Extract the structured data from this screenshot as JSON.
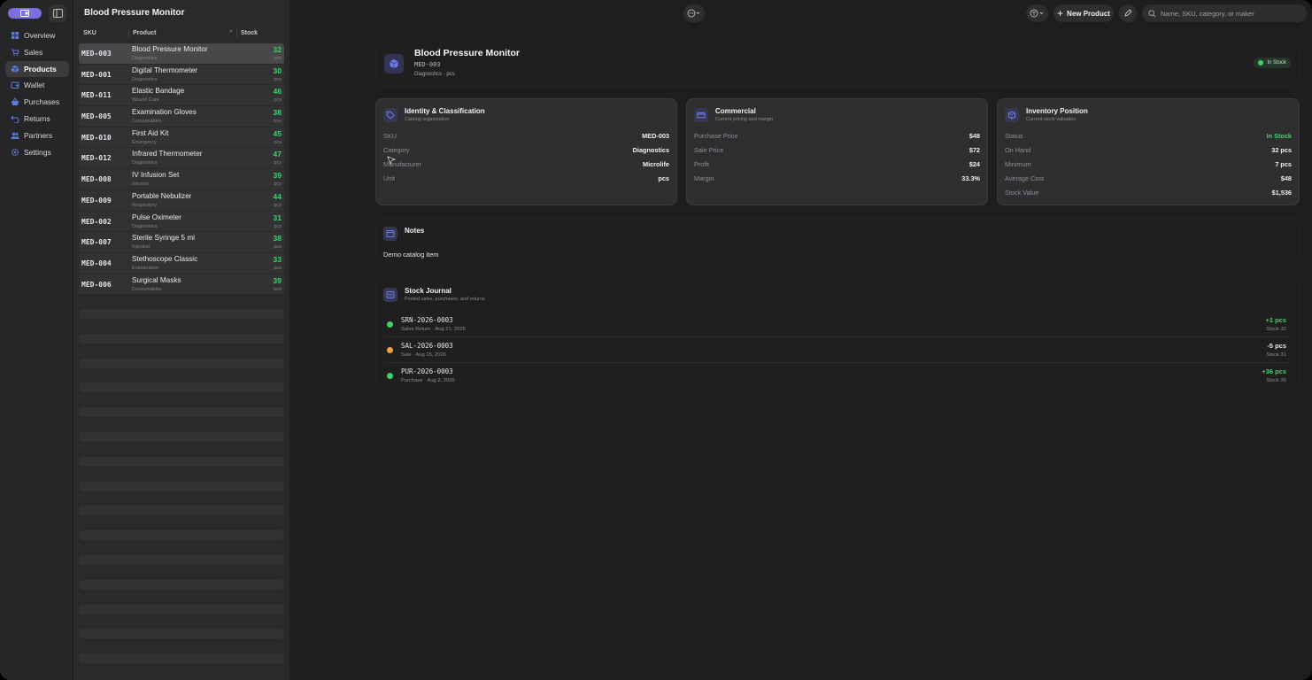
{
  "sidebar": {
    "items": [
      {
        "label": "Overview",
        "icon": "grid-icon"
      },
      {
        "label": "Sales",
        "icon": "cart-icon"
      },
      {
        "label": "Products",
        "icon": "box-icon",
        "active": true
      },
      {
        "label": "Wallet",
        "icon": "wallet-icon"
      },
      {
        "label": "Purchases",
        "icon": "basket-icon"
      },
      {
        "label": "Returns",
        "icon": "return-icon"
      },
      {
        "label": "Partners",
        "icon": "people-icon"
      },
      {
        "label": "Settings",
        "icon": "gear-icon"
      }
    ]
  },
  "list": {
    "title": "Blood Pressure Monitor",
    "columns": {
      "sku": "SKU",
      "product": "Product",
      "stock": "Stock"
    },
    "rows": [
      {
        "sku": "MED-003",
        "name": "Blood Pressure Monitor",
        "category": "Diagnostics",
        "stock": "32",
        "unit": "pcs"
      },
      {
        "sku": "MED-001",
        "name": "Digital Thermometer",
        "category": "Diagnostics",
        "stock": "30",
        "unit": "pcs"
      },
      {
        "sku": "MED-011",
        "name": "Elastic Bandage",
        "category": "Wound Care",
        "stock": "46",
        "unit": "pcs"
      },
      {
        "sku": "MED-005",
        "name": "Examination Gloves",
        "category": "Consumables",
        "stock": "38",
        "unit": "box"
      },
      {
        "sku": "MED-010",
        "name": "First Aid Kit",
        "category": "Emergency",
        "stock": "45",
        "unit": "pcs"
      },
      {
        "sku": "MED-012",
        "name": "Infrared Thermometer",
        "category": "Diagnostics",
        "stock": "47",
        "unit": "pcs"
      },
      {
        "sku": "MED-008",
        "name": "IV Infusion Set",
        "category": "Infusion",
        "stock": "39",
        "unit": "pcs"
      },
      {
        "sku": "MED-009",
        "name": "Portable Nebulizer",
        "category": "Respiratory",
        "stock": "44",
        "unit": "pcs"
      },
      {
        "sku": "MED-002",
        "name": "Pulse Oximeter",
        "category": "Diagnostics",
        "stock": "31",
        "unit": "pcs"
      },
      {
        "sku": "MED-007",
        "name": "Sterile Syringe 5 ml",
        "category": "Injection",
        "stock": "38",
        "unit": "pcs"
      },
      {
        "sku": "MED-004",
        "name": "Stethoscope Classic",
        "category": "Examination",
        "stock": "33",
        "unit": "pcs"
      },
      {
        "sku": "MED-006",
        "name": "Surgical Masks",
        "category": "Consumables",
        "stock": "39",
        "unit": "box"
      }
    ]
  },
  "toolbar": {
    "new_label": "New Product",
    "search_placeholder": "Name, SKU, category, or maker"
  },
  "product": {
    "title": "Blood Pressure Monitor",
    "sku": "MED-003",
    "subtitle": "Diagnostics · pcs",
    "status_badge": "In Stock"
  },
  "identity": {
    "title": "Identity & Classification",
    "subtitle": "Catalog organization",
    "rows": [
      {
        "k": "SKU",
        "v": "MED-003"
      },
      {
        "k": "Category",
        "v": "Diagnostics"
      },
      {
        "k": "Manufacturer",
        "v": "Microlife"
      },
      {
        "k": "Unit",
        "v": "pcs"
      }
    ]
  },
  "commercial": {
    "title": "Commercial",
    "subtitle": "Current pricing and margin",
    "rows": [
      {
        "k": "Purchase Price",
        "v": "$48"
      },
      {
        "k": "Sale Price",
        "v": "$72"
      },
      {
        "k": "Profit",
        "v": "$24"
      },
      {
        "k": "Margin",
        "v": "33.3%"
      }
    ]
  },
  "inventory": {
    "title": "Inventory Position",
    "subtitle": "Current stock valuation",
    "rows": [
      {
        "k": "Status",
        "v": "In Stock"
      },
      {
        "k": "On Hand",
        "v": "32 pcs"
      },
      {
        "k": "Minimum",
        "v": "7 pcs"
      },
      {
        "k": "Average Cost",
        "v": "$48"
      },
      {
        "k": "Stock Value",
        "v": "$1,536"
      }
    ]
  },
  "notes": {
    "title": "Notes",
    "text": "Demo catalog item"
  },
  "journal": {
    "title": "Stock Journal",
    "subtitle": "Posted sales, purchases, and returns",
    "entries": [
      {
        "ref": "SRN-2026-0003",
        "desc": "Sales Return · Aug 21, 2026",
        "qty": "+1 pcs",
        "balance": "Stock 32",
        "color": "#3bd36a"
      },
      {
        "ref": "SAL-2026-0003",
        "desc": "Sale · Aug 15, 2026",
        "qty": "-5 pcs",
        "balance": "Stock 31",
        "color": "#f0a040"
      },
      {
        "ref": "PUR-2026-0003",
        "desc": "Purchase · Aug 2, 2026",
        "qty": "+36 pcs",
        "balance": "Stock 36",
        "color": "#3bd36a"
      }
    ]
  },
  "colors": {
    "accent": "#7b6fe0",
    "positive": "#3bd36a",
    "warning": "#f0a040"
  }
}
